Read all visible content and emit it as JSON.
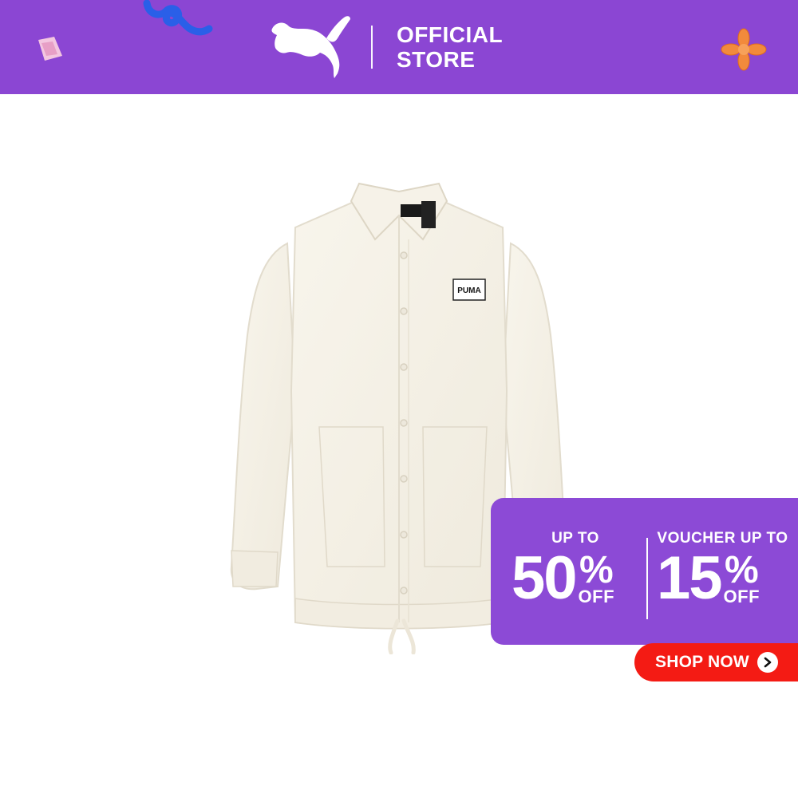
{
  "header": {
    "store_line1": "OFFICIAL",
    "store_line2": "STORE",
    "background_color": "#8b46d3",
    "logo_icon": "puma-cat-logo-icon"
  },
  "product": {
    "image_description_icon": "white-coach-jacket-image",
    "chest_badge": "PUMA"
  },
  "promo": {
    "left_label": "UP TO",
    "left_value": "50",
    "left_percent": "%",
    "left_off": "OFF",
    "right_label": "VOUCHER UP TO",
    "right_value": "15",
    "right_percent": "%",
    "right_off": "OFF",
    "background_color": "#8c4ad6"
  },
  "cta": {
    "label": "SHOP NOW",
    "icon": "arrow-right-icon",
    "background_color": "#f41b14"
  },
  "decorations": [
    "blue-squiggle-icon",
    "pink-paper-icon",
    "orange-asterisk-icon"
  ]
}
